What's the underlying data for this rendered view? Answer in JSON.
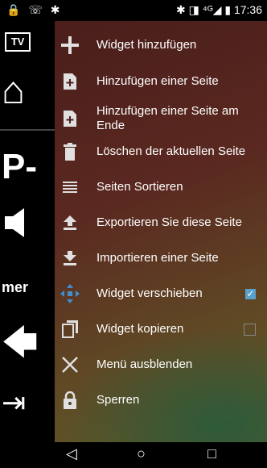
{
  "status_bar": {
    "left_icons": "🔒 ☏ ✱",
    "right_icons": "✱ ◨ ⁴ᴳ◢ ▮",
    "time": "17:36"
  },
  "background": {
    "tv_label": "TV",
    "p_label": "P-",
    "mer_label": "mer"
  },
  "menu": {
    "items": [
      {
        "label": "Widget hinzufügen",
        "icon": "plus-icon"
      },
      {
        "label": "Hinzufügen einer Seite",
        "icon": "add-page-icon"
      },
      {
        "label": "Hinzufügen einer Seite am Ende",
        "icon": "add-page-end-icon"
      },
      {
        "label": "Löschen der aktuellen Seite",
        "icon": "trash-icon"
      },
      {
        "label": "Seiten Sortieren",
        "icon": "sort-lines-icon"
      },
      {
        "label": "Exportieren Sie diese Seite",
        "icon": "export-icon"
      },
      {
        "label": "Importieren einer Seite",
        "icon": "import-icon"
      },
      {
        "label": "Widget verschieben",
        "icon": "move-icon",
        "checkbox": true
      },
      {
        "label": "Widget kopieren",
        "icon": "copy-icon",
        "checkbox": false
      },
      {
        "label": "Menü ausblenden",
        "icon": "close-icon"
      },
      {
        "label": "Sperren",
        "icon": "lock-icon"
      }
    ]
  },
  "nav_bar": {
    "back": "◁",
    "home": "○",
    "recents": "□"
  }
}
